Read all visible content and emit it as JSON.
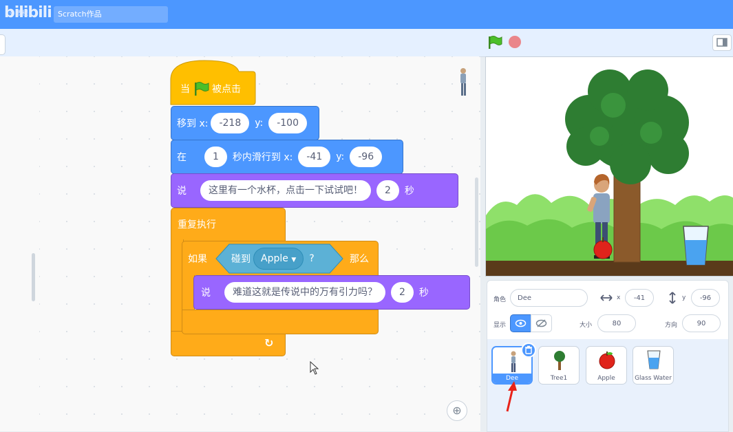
{
  "topbar": {
    "title_value": "Scratch作品",
    "logo_text": "bilibili",
    "logo_small": "☼ 教程"
  },
  "code": {
    "hat": {
      "when": "当",
      "clicked": "被点击"
    },
    "goto": {
      "label": "移到 x:",
      "x": "-218",
      "ylabel": "y:",
      "y": "-100"
    },
    "glide": {
      "in": "在",
      "secs": "1",
      "label": "秒内滑行到 x:",
      "x": "-41",
      "ylabel": "y:",
      "y": "-96"
    },
    "say1": {
      "say": "说",
      "text": "这里有一个水杯，点击一下试试吧！",
      "secs": "2",
      "unit": "秒"
    },
    "forever": {
      "label": "重复执行",
      "arrow": "↻"
    },
    "if": {
      "label": "如果",
      "touch": "碰到",
      "target": "Apple",
      "q": "?",
      "then": "那么"
    },
    "say2": {
      "say": "说",
      "text": "难道这就是传说中的万有引力吗？",
      "secs": "2",
      "unit": "秒"
    },
    "zoom_in": "⊕"
  },
  "sprite_info": {
    "sprite_label": "角色",
    "sprite_name": "Dee",
    "x_label": "x",
    "x_value": "-41",
    "y_label": "y",
    "y_value": "-96",
    "show_label": "显示",
    "size_label": "大小",
    "size_value": "80",
    "direction_label": "方向",
    "direction_value": "90"
  },
  "sprites": [
    {
      "name": "Dee"
    },
    {
      "name": "Tree1"
    },
    {
      "name": "Apple"
    },
    {
      "name": "Glass Water"
    }
  ],
  "colors": {
    "motion": "#4c97ff",
    "looks": "#9966ff",
    "events": "#ffbf00",
    "control": "#ffab19",
    "menu_bar": "#4c97ff"
  }
}
